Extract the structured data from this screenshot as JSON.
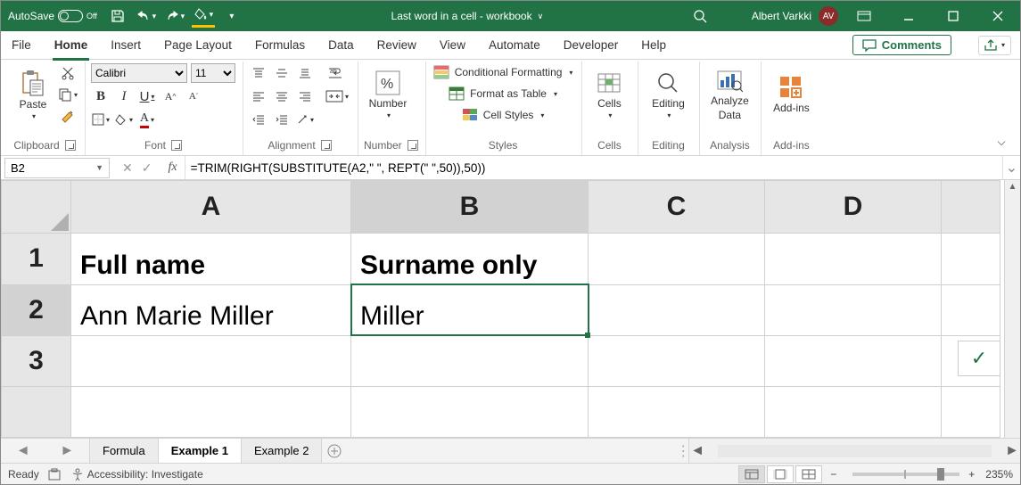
{
  "titlebar": {
    "autosave_label": "AutoSave",
    "autosave_state": "Off",
    "title": "Last word in a cell - workbook",
    "user_name": "Albert Varkki",
    "user_initials": "AV"
  },
  "tabs": {
    "file": "File",
    "home": "Home",
    "insert": "Insert",
    "page_layout": "Page Layout",
    "formulas": "Formulas",
    "data": "Data",
    "review": "Review",
    "view": "View",
    "automate": "Automate",
    "developer": "Developer",
    "help": "Help",
    "comments": "Comments"
  },
  "ribbon": {
    "clipboard": {
      "label": "Clipboard",
      "paste": "Paste"
    },
    "font": {
      "label": "Font",
      "font_name": "Calibri",
      "font_size": "11",
      "bold": "B",
      "italic": "I",
      "underline": "U"
    },
    "alignment": {
      "label": "Alignment"
    },
    "number": {
      "label": "Number",
      "btn": "Number"
    },
    "styles": {
      "label": "Styles",
      "cond_format": "Conditional Formatting",
      "as_table": "Format as Table",
      "cell_styles": "Cell Styles"
    },
    "cells": {
      "label": "Cells",
      "btn": "Cells"
    },
    "editing": {
      "label": "Editing",
      "btn": "Editing"
    },
    "analysis": {
      "label": "Analysis",
      "btn1": "Analyze",
      "btn2": "Data"
    },
    "addins": {
      "label": "Add-ins",
      "btn": "Add-ins"
    }
  },
  "formula_bar": {
    "cell_ref": "B2",
    "formula": "=TRIM(RIGHT(SUBSTITUTE(A2,\" \", REPT(\" \",50)),50))"
  },
  "columns": [
    "A",
    "B",
    "C",
    "D"
  ],
  "rows": [
    "1",
    "2",
    "3"
  ],
  "cells": {
    "A1": "Full name",
    "B1": "Surname only",
    "A2": "Ann Marie Miller",
    "B2": "Miller"
  },
  "sheet_tabs": [
    "Formula",
    "Example 1",
    "Example 2"
  ],
  "active_sheet": "Example 1",
  "status": {
    "ready": "Ready",
    "accessibility": "Accessibility: Investigate",
    "zoom": "235%"
  }
}
